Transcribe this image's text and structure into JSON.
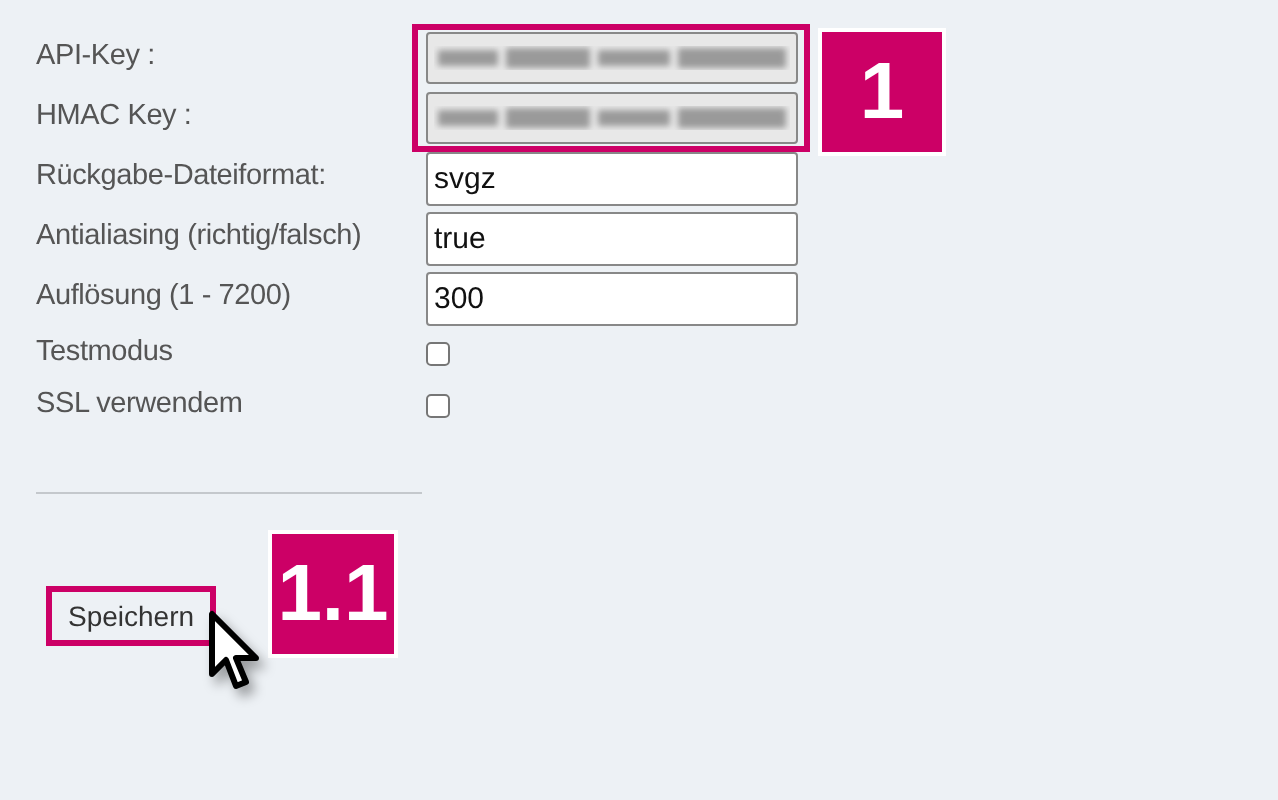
{
  "settings": [
    {
      "kind": "secret",
      "label": "API-Key :"
    },
    {
      "kind": "secret",
      "label": "HMAC Key :"
    },
    {
      "kind": "text",
      "label": "Rückgabe-Dateiformat:",
      "value": "svgz"
    },
    {
      "kind": "text",
      "label": "Antialiasing (richtig/falsch)",
      "value": "true"
    },
    {
      "kind": "text",
      "label": "Auflösung (1 - 7200)",
      "value": "300"
    },
    {
      "kind": "checkbox",
      "label": "Testmodus",
      "checked": false
    },
    {
      "kind": "checkbox",
      "label": "SSL verwendem",
      "checked": false
    }
  ],
  "save_button": {
    "label": "Speichern"
  },
  "callouts": [
    {
      "label": "1"
    },
    {
      "label": "1.1"
    }
  ]
}
